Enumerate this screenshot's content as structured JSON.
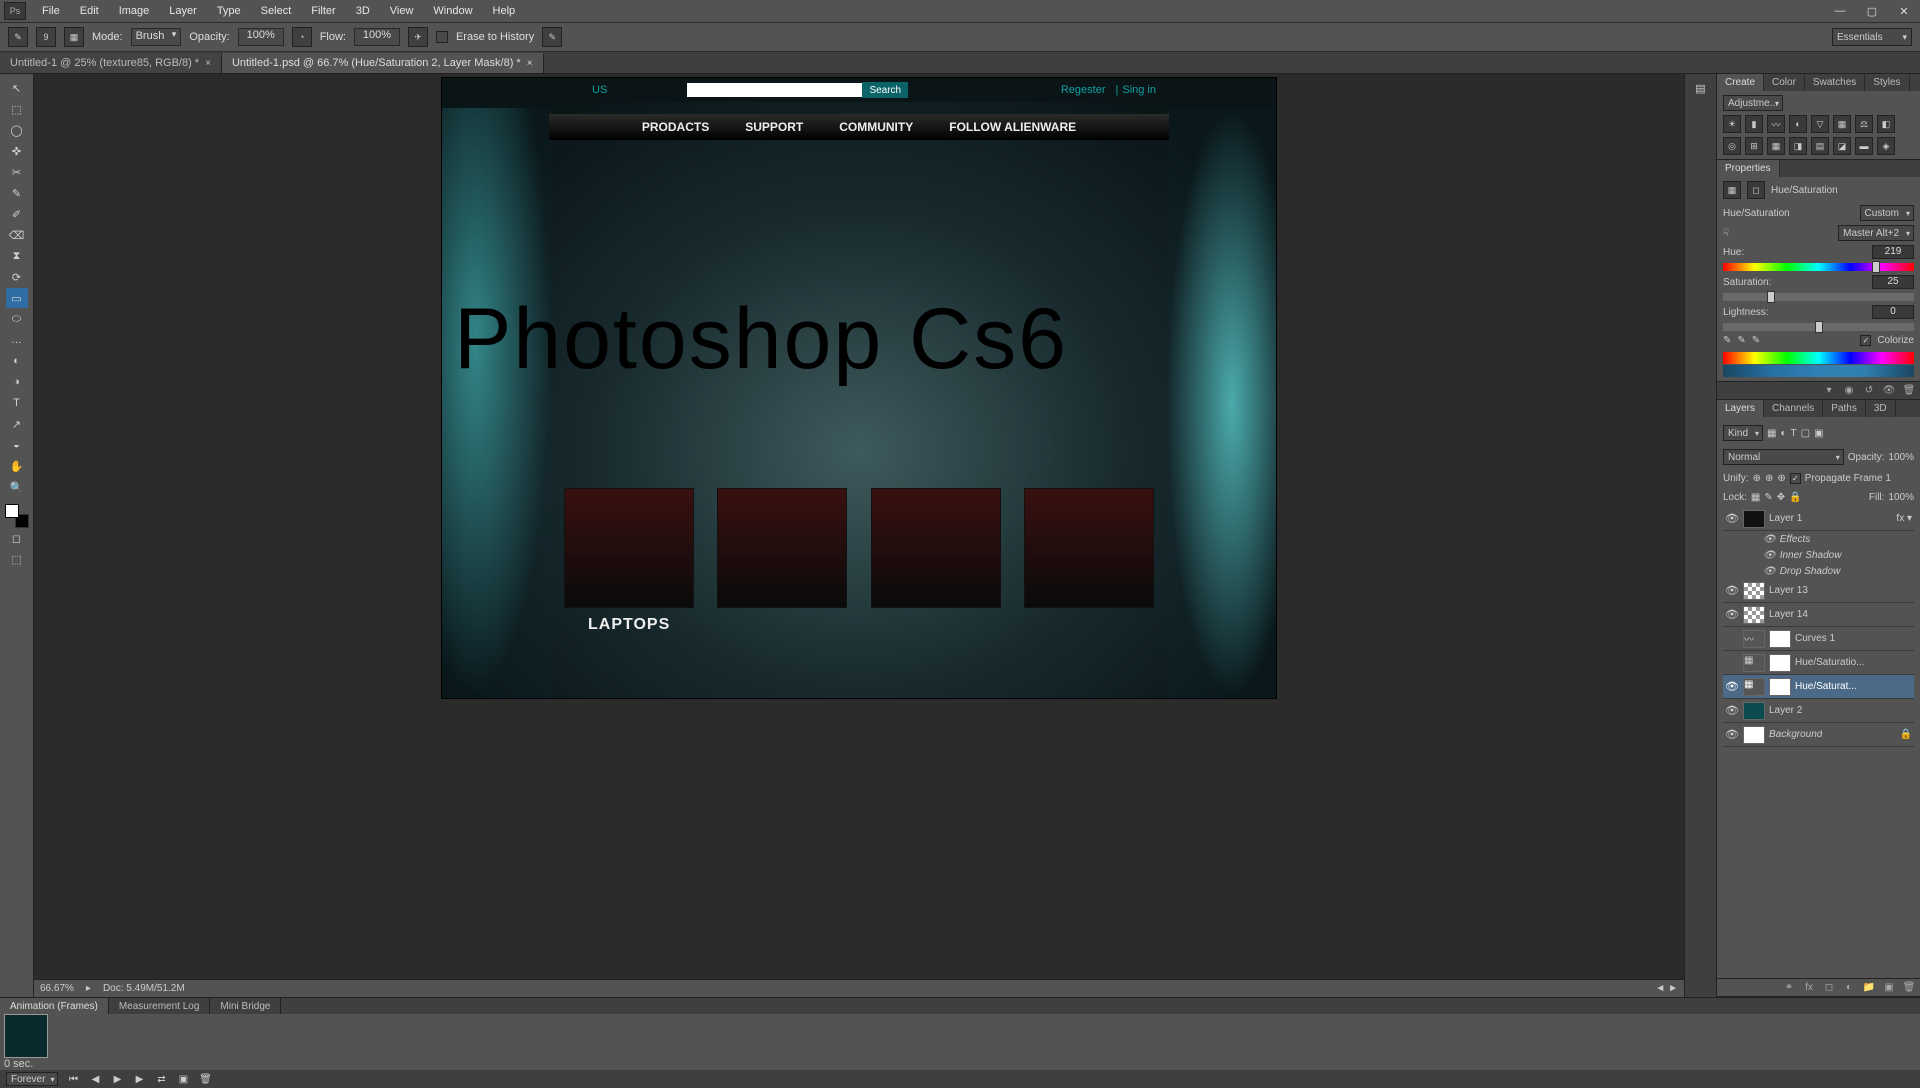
{
  "menubar": {
    "logo": "Ps",
    "items": [
      "File",
      "Edit",
      "Image",
      "Layer",
      "Type",
      "Select",
      "Filter",
      "3D",
      "View",
      "Window",
      "Help"
    ]
  },
  "optionsbar": {
    "brush_size": "9",
    "mode_label": "Mode:",
    "mode_value": "Brush",
    "opacity_label": "Opacity:",
    "opacity_value": "100%",
    "flow_label": "Flow:",
    "flow_value": "100%",
    "erase_label": "Erase to History",
    "workspace": "Essentials"
  },
  "tabs": [
    {
      "label": "Untitled-1 @ 25% (texture85, RGB/8) *"
    },
    {
      "label": "Untitled-1.psd @ 66.7% (Hue/Saturation 2, Layer Mask/8) *"
    }
  ],
  "tools": [
    "↖",
    "⬚",
    "◯",
    "✜",
    "✂",
    "✎",
    "✐",
    "⌫",
    "⧗",
    "⟳",
    "▭",
    "⬭",
    "…",
    "◐",
    "◑",
    "◒",
    "T",
    "↗",
    "✋",
    "🔍"
  ],
  "canvas": {
    "topstrip": {
      "us": "US",
      "search_btn": "Search",
      "register": "Regester",
      "signin": "Sing in"
    },
    "nav": [
      "PRODACTS",
      "SUPPORT",
      "COMMUNITY",
      "FOLLOW ALIENWARE"
    ],
    "hero": "Photoshop Cs6",
    "laptops": "LAPTOPS"
  },
  "canvas_status": {
    "zoom": "66.67%",
    "docinfo": "Doc: 5.49M/51.2M"
  },
  "bottom": {
    "tabs": [
      "Animation (Frames)",
      "Measurement Log",
      "Mini Bridge"
    ],
    "frame_dur": "0 sec.",
    "loop": "Forever"
  },
  "right": {
    "create_tabs": [
      "Create",
      "Color",
      "Swatches",
      "Styles"
    ],
    "adj_select": "Adjustme...",
    "props_tab": "Properties",
    "props_title": "Hue/Saturation",
    "props_header_label": "Hue/Saturation",
    "props_custom": "Custom",
    "master": "Master Alt+2",
    "hue_label": "Hue:",
    "hue_value": "219",
    "sat_label": "Saturation:",
    "sat_value": "25",
    "light_label": "Lightness:",
    "light_value": "0",
    "colorize_label": "Colorize",
    "layers_tabs": [
      "Layers",
      "Channels",
      "Paths",
      "3D"
    ],
    "kind": "Kind",
    "blend": "Normal",
    "opacity_label": "Opacity:",
    "opacity_val": "100%",
    "fill_label": "Fill:",
    "fill_val": "100%",
    "unify": "Unify:",
    "propagate": "Propagate Frame 1",
    "lock_label": "Lock:",
    "layers": [
      {
        "name": "Layer 1",
        "eye": true,
        "fx": true
      },
      {
        "name": "Effects",
        "sub": true
      },
      {
        "name": "Inner Shadow",
        "sub": true
      },
      {
        "name": "Drop Shadow",
        "sub": true
      },
      {
        "name": "Layer 13",
        "eye": true,
        "checker": true
      },
      {
        "name": "Layer 14",
        "eye": true,
        "checker": true
      },
      {
        "name": "Curves 1",
        "eye": false,
        "adj": true
      },
      {
        "name": "Hue/Saturatio...",
        "eye": false,
        "adj": true
      },
      {
        "name": "Hue/Saturat...",
        "eye": true,
        "adj": true,
        "sel": true
      },
      {
        "name": "Layer 2",
        "eye": true
      },
      {
        "name": "Background",
        "eye": true,
        "locked": true
      }
    ]
  }
}
